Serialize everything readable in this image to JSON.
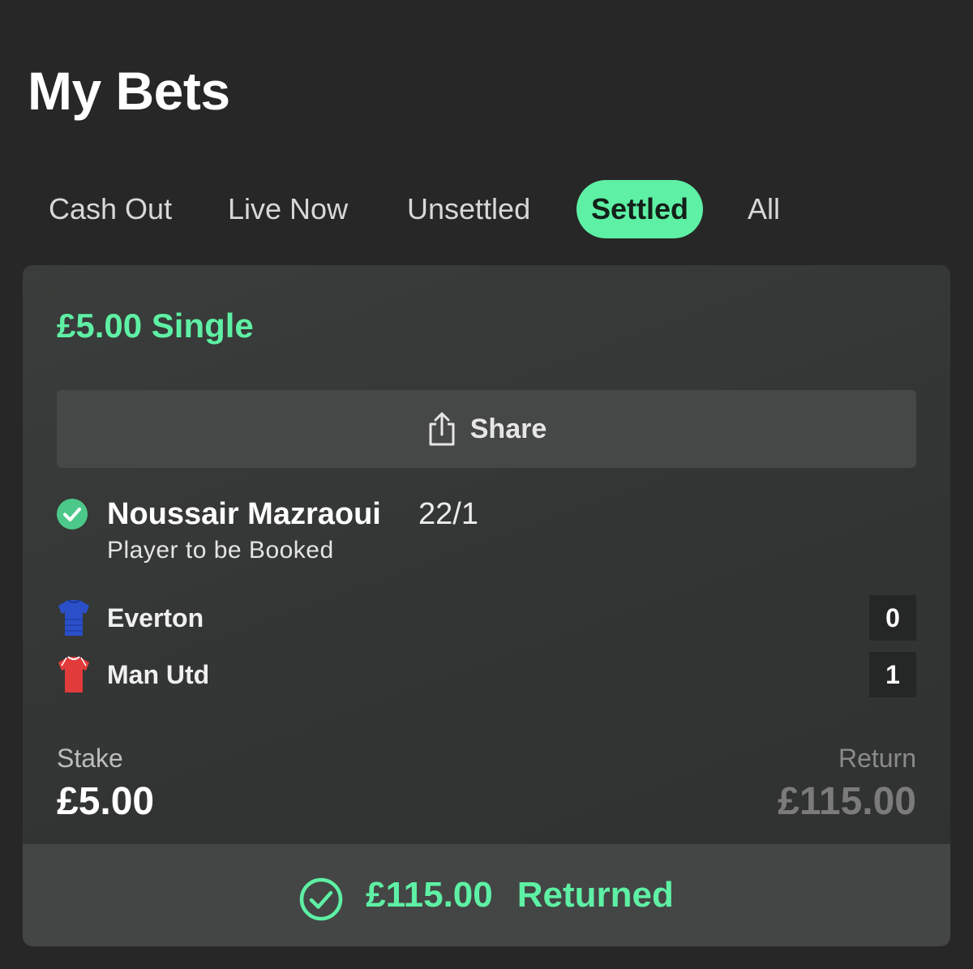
{
  "header": {
    "title": "My Bets"
  },
  "tabs": [
    {
      "label": "Cash Out",
      "active": false
    },
    {
      "label": "Live Now",
      "active": false
    },
    {
      "label": "Unsettled",
      "active": false
    },
    {
      "label": "Settled",
      "active": true
    },
    {
      "label": "All",
      "active": false
    }
  ],
  "bet": {
    "type_label": "£5.00 Single",
    "share_label": "Share",
    "share_icon": "share-icon",
    "selection": {
      "status_icon": "check-circle-icon",
      "player": "Noussair Mazraoui",
      "odds": "22/1",
      "market": "Player to be Booked"
    },
    "teams": [
      {
        "name": "Everton",
        "score": "0",
        "kit_color": "#2a4fc9",
        "icon": "shirt-icon"
      },
      {
        "name": "Man Utd",
        "score": "1",
        "kit_color": "#e23b3b",
        "icon": "shirt-icon"
      }
    ],
    "stake_label": "Stake",
    "stake_value": "£5.00",
    "return_label": "Return",
    "return_value": "£115.00",
    "returned": {
      "icon": "check-circle-outline-icon",
      "amount": "£115.00",
      "label": "Returned"
    }
  },
  "colors": {
    "accent": "#5ef0a4",
    "background": "#272727",
    "card": "#353837",
    "button": "#454847"
  }
}
